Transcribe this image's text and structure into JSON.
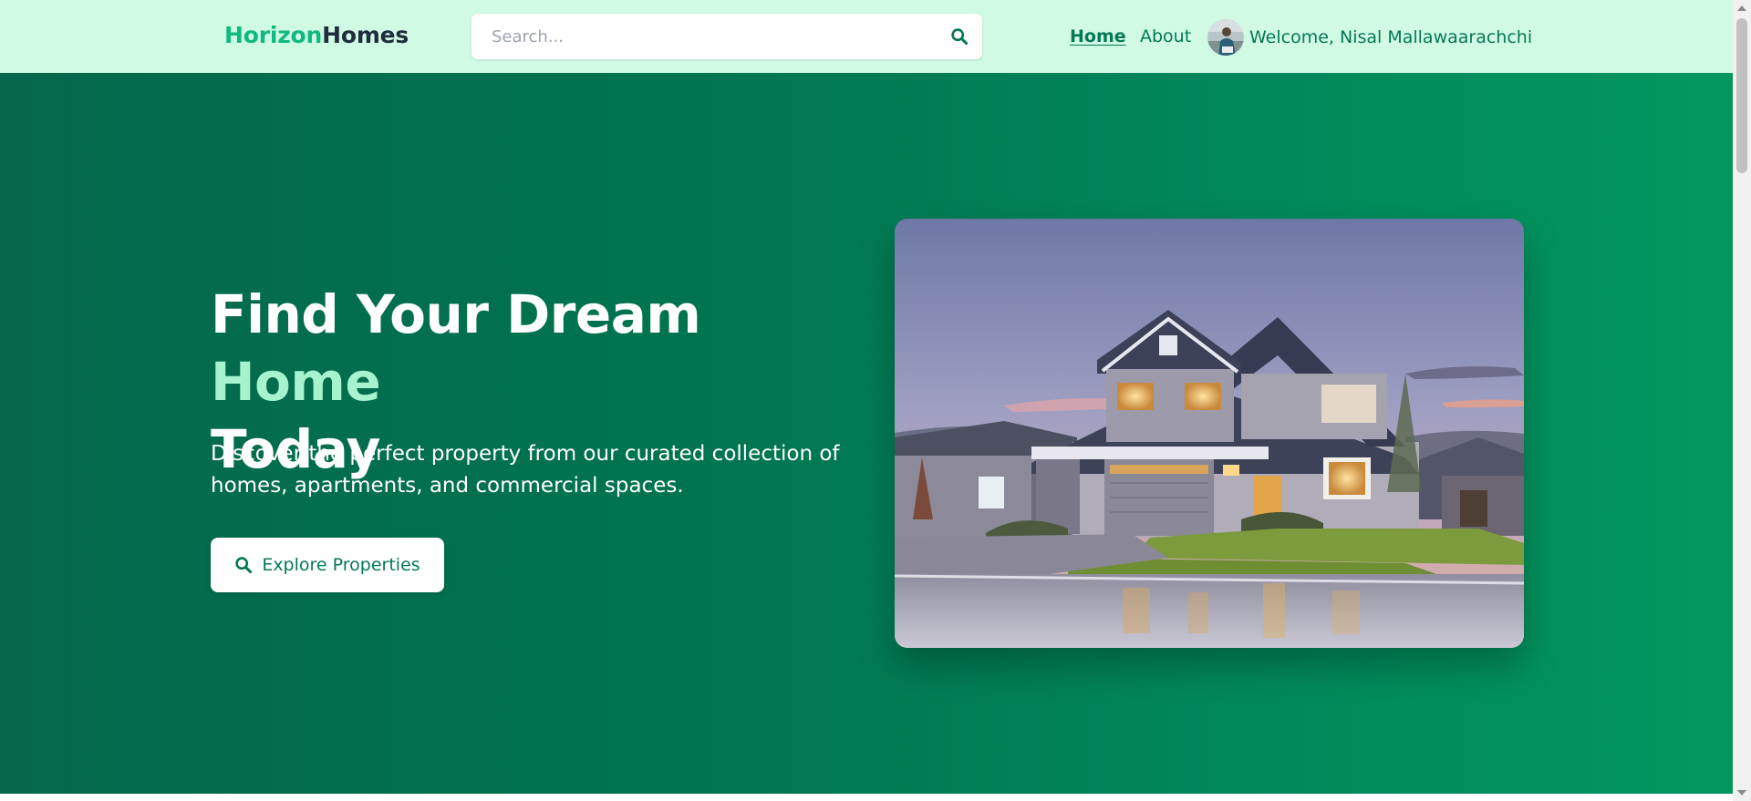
{
  "navbar": {
    "logo": {
      "part1": "Horizon",
      "part2": "Homes"
    },
    "search": {
      "placeholder": "Search..."
    },
    "links": [
      {
        "label": "Home",
        "active": true
      },
      {
        "label": "About",
        "active": false
      }
    ],
    "user": {
      "welcome": "Welcome, Nisal Mallawaarachchi"
    }
  },
  "hero": {
    "title_part1": "Find Your Dream ",
    "title_accent": "Home",
    "title_part2": "Today",
    "subtitle": "Discover the perfect property from our curated collection of homes, apartments, and commercial spaces.",
    "cta_label": "Explore Properties"
  },
  "icons": {
    "search": "search-icon",
    "cta": "search-icon",
    "avatar": "avatar-image",
    "hero": "house-photo"
  },
  "colors": {
    "nav_bg": "#d1fae5",
    "logo_accent": "#10b981",
    "logo_dark": "#1f2d3d",
    "nav_text": "#047857",
    "hero_green": "#00744f",
    "title_accent": "#a7f3d0"
  }
}
